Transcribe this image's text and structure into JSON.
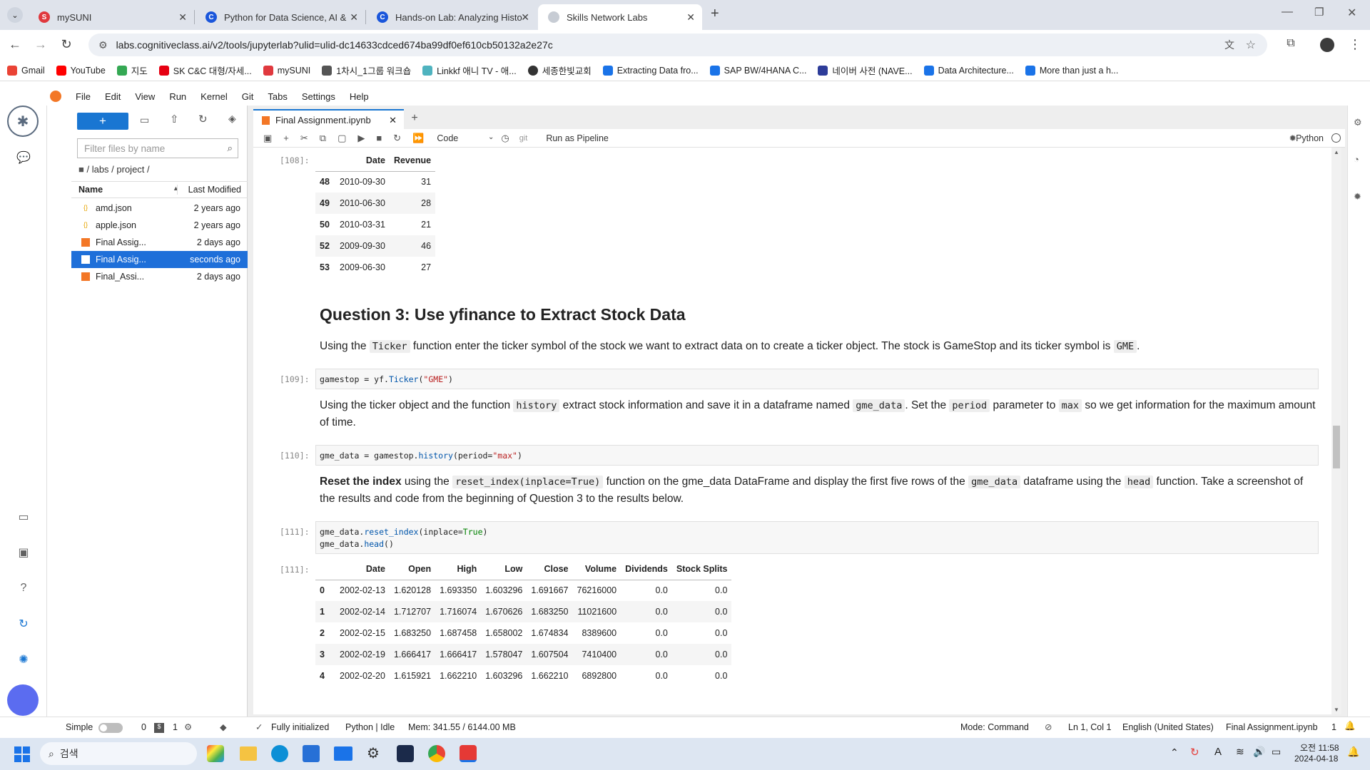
{
  "browser": {
    "tabs": [
      {
        "title": "mySUNI",
        "fav_color": "#e0393e",
        "fav_text": "S"
      },
      {
        "title": "Python for Data Science, AI &",
        "fav_color": "#1a56db",
        "fav_text": "C"
      },
      {
        "title": "Hands-on Lab: Analyzing Histo",
        "fav_color": "#1a56db",
        "fav_text": "C"
      },
      {
        "title": "Skills Network Labs",
        "fav_color": "#c7ccd4",
        "fav_text": ""
      }
    ],
    "url": "labs.cognitiveclass.ai/v2/tools/jupyterlab?ulid=ulid-dc14633cdced674ba99df0ef610cb50132a2e27c",
    "bookmarks": [
      {
        "label": "Gmail",
        "color": "#ea4335"
      },
      {
        "label": "YouTube",
        "color": "#ff0000"
      },
      {
        "label": "지도",
        "color": "#34a853"
      },
      {
        "label": "SK C&C 대형/자세...",
        "color": "#e60012"
      },
      {
        "label": "mySUNI",
        "color": "#e0393e"
      },
      {
        "label": "1차시_1그룹 워크숍",
        "color": "#555555"
      },
      {
        "label": "Linkkf 애니 TV - 애...",
        "color": "#4fb3bf"
      },
      {
        "label": "세종한빛교회",
        "color": "#333333"
      },
      {
        "label": "Extracting Data fro...",
        "color": "#1a73e8"
      },
      {
        "label": "SAP BW/4HANA C...",
        "color": "#1a73e8"
      },
      {
        "label": "네이버 사전 (NAVE...",
        "color": "#2d3c99"
      },
      {
        "label": "Data Architecture...",
        "color": "#1a73e8"
      },
      {
        "label": "More than just a h...",
        "color": "#1a73e8"
      }
    ]
  },
  "menu": [
    "File",
    "Edit",
    "View",
    "Run",
    "Kernel",
    "Git",
    "Tabs",
    "Settings",
    "Help"
  ],
  "filebrowser": {
    "new_label": "+",
    "filter_placeholder": "Filter files by name",
    "breadcrumb": "/ labs / project /",
    "col_name": "Name",
    "col_modified": "Last Modified",
    "files": [
      {
        "name": "amd.json",
        "modified": "2 years ago",
        "type": "json",
        "selected": false
      },
      {
        "name": "apple.json",
        "modified": "2 years ago",
        "type": "json",
        "selected": false
      },
      {
        "name": "Final Assig...",
        "modified": "2 days ago",
        "type": "notebook",
        "selected": false
      },
      {
        "name": "Final Assig...",
        "modified": "seconds ago",
        "type": "notebook",
        "selected": true
      },
      {
        "name": "Final_Assi...",
        "modified": "2 days ago",
        "type": "notebook",
        "selected": false
      }
    ]
  },
  "notebook": {
    "tab_title": "Final Assignment.ipynb",
    "cell_type": "Code",
    "git_label": "git",
    "pipeline_label": "Run as Pipeline",
    "kernel": "Python",
    "out108_prompt": "[108]:",
    "revenue_table": {
      "headers": [
        "",
        "Date",
        "Revenue"
      ],
      "rows": [
        [
          "48",
          "2010-09-30",
          "31"
        ],
        [
          "49",
          "2010-06-30",
          "28"
        ],
        [
          "50",
          "2010-03-31",
          "21"
        ],
        [
          "52",
          "2009-09-30",
          "46"
        ],
        [
          "53",
          "2009-06-30",
          "27"
        ]
      ]
    },
    "q3_heading": "Question 3: Use yfinance to Extract Stock Data",
    "q3_p1": {
      "a": "Using the ",
      "code1": "Ticker",
      "b": " function enter the ticker symbol of the stock we want to extract data on to create a ticker object. The stock is GameStop and its ticker symbol is ",
      "code2": "GME",
      "c": "."
    },
    "cell109_prompt": "[109]:",
    "cell109": {
      "a": "gamestop = yf.",
      "b": "Ticker",
      "c": "(",
      "d": "\"GME\"",
      "e": ")"
    },
    "q3_p2": {
      "a": "Using the ticker object and the function ",
      "code1": "history",
      "b": " extract stock information and save it in a dataframe named ",
      "code2": "gme_data",
      "c": ". Set the ",
      "code3": "period",
      "d": " parameter to ",
      "code4": "max",
      "e": " so we get information for the maximum amount of time."
    },
    "cell110_prompt": "[110]:",
    "cell110": {
      "a": "gme_data = gamestop.",
      "b": "history",
      "c": "(period=",
      "d": "\"max\"",
      "e": ")"
    },
    "q3_p3": {
      "bold": "Reset the index",
      "a": " using the ",
      "code1": "reset_index(inplace=True)",
      "b": " function on the gme_data DataFrame and display the first five rows of the ",
      "code2": "gme_data",
      "c": " dataframe using the ",
      "code3": "head",
      "d": " function. Take a screenshot of the results and code from the beginning of Question 3 to the results below."
    },
    "cell111_prompt": "[111]:",
    "cell111": {
      "l1a": "gme_data.",
      "l1b": "reset_index",
      "l1c": "(inplace=",
      "l1d": "True",
      "l1e": ")",
      "l2a": "gme_data.",
      "l2b": "head",
      "l2c": "()"
    },
    "out111_prompt": "[111]:",
    "gme_table": {
      "headers": [
        "",
        "Date",
        "Open",
        "High",
        "Low",
        "Close",
        "Volume",
        "Dividends",
        "Stock Splits"
      ],
      "rows": [
        [
          "0",
          "2002-02-13",
          "1.620128",
          "1.693350",
          "1.603296",
          "1.691667",
          "76216000",
          "0.0",
          "0.0"
        ],
        [
          "1",
          "2002-02-14",
          "1.712707",
          "1.716074",
          "1.670626",
          "1.683250",
          "11021600",
          "0.0",
          "0.0"
        ],
        [
          "2",
          "2002-02-15",
          "1.683250",
          "1.687458",
          "1.658002",
          "1.674834",
          "8389600",
          "0.0",
          "0.0"
        ],
        [
          "3",
          "2002-02-19",
          "1.666417",
          "1.666417",
          "1.578047",
          "1.607504",
          "7410400",
          "0.0",
          "0.0"
        ],
        [
          "4",
          "2002-02-20",
          "1.615921",
          "1.662210",
          "1.603296",
          "1.662210",
          "6892800",
          "0.0",
          "0.0"
        ]
      ]
    }
  },
  "status": {
    "mode_simple": "Simple",
    "count0": "0",
    "count1": "1",
    "initialized": "Fully initialized",
    "kernel_status": "Python | Idle",
    "memory": "Mem: 341.55 / 6144.00 MB",
    "mode": "Mode: Command",
    "cursor": "Ln 1, Col 1",
    "language": "English (United States)",
    "file": "Final Assignment.ipynb",
    "notif": "1"
  },
  "taskbar": {
    "search_placeholder": "검색",
    "time": "오전 11:58",
    "date": "2024-04-18"
  },
  "colors": {
    "accent": "#1976d2",
    "selected_row": "#1e6fd9"
  }
}
